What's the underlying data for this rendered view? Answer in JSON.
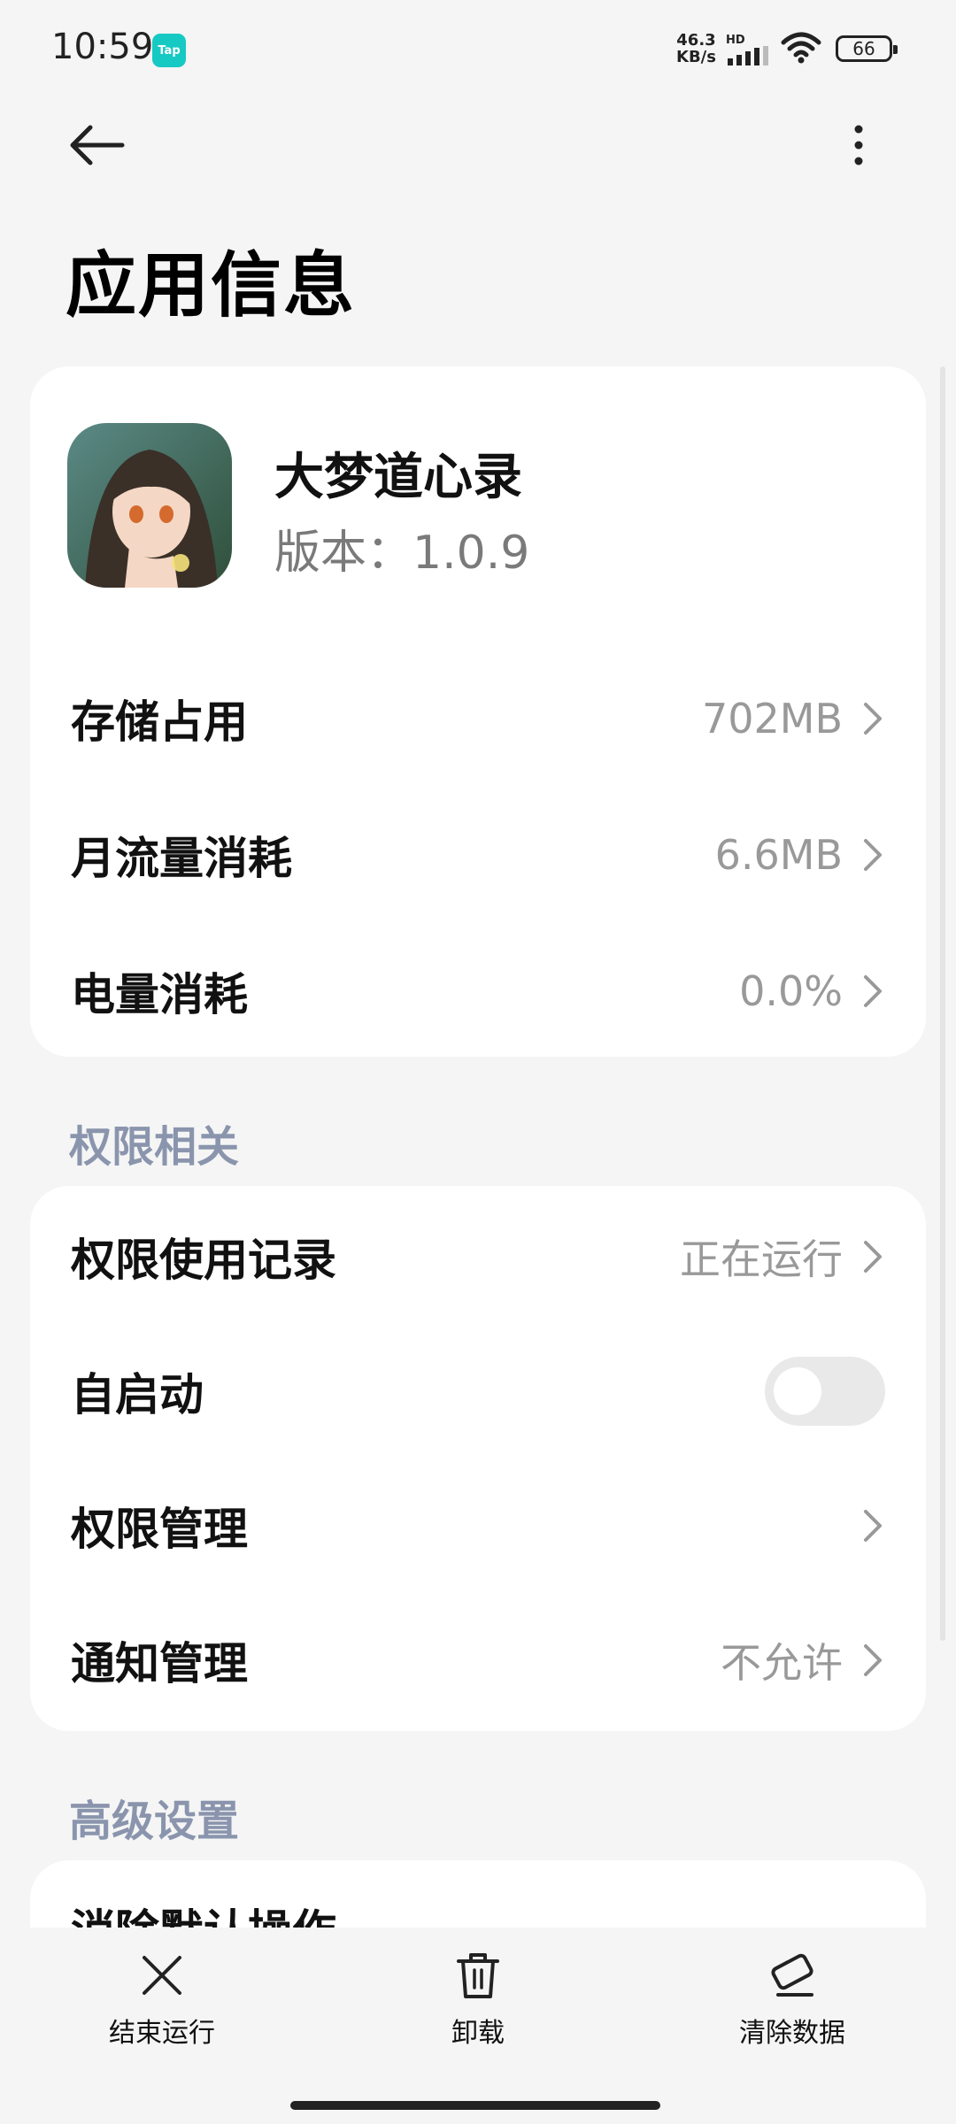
{
  "status_bar": {
    "time": "10:59",
    "app_badge": "Tap",
    "net_speed_value": "46.3",
    "net_speed_unit": "KB/s",
    "network_type": "HD",
    "battery": "66"
  },
  "header": {
    "title": "应用信息",
    "back_icon": "arrow-left-icon",
    "more_icon": "more-vertical-icon"
  },
  "app": {
    "name": "大梦道心录",
    "version": "版本：1.0.9"
  },
  "usage_rows": [
    {
      "label": "存储占用",
      "value": "702MB"
    },
    {
      "label": "月流量消耗",
      "value": "6.6MB"
    },
    {
      "label": "电量消耗",
      "value": "0.0%"
    }
  ],
  "permissions": {
    "section_title": "权限相关",
    "usage_record": {
      "label": "权限使用记录",
      "value": "正在运行"
    },
    "autostart": {
      "label": "自启动",
      "enabled": false
    },
    "management": {
      "label": "权限管理"
    },
    "notifications": {
      "label": "通知管理",
      "value": "不允许"
    }
  },
  "advanced": {
    "section_title": "高级设置",
    "first_item": "消除默认操作"
  },
  "bottom_actions": [
    {
      "label": "结束运行",
      "icon": "close-icon"
    },
    {
      "label": "卸载",
      "icon": "trash-icon"
    },
    {
      "label": "清除数据",
      "icon": "eraser-icon"
    }
  ],
  "colors": {
    "accent_section": "#8a95ad",
    "badge": "#17c9c3"
  }
}
